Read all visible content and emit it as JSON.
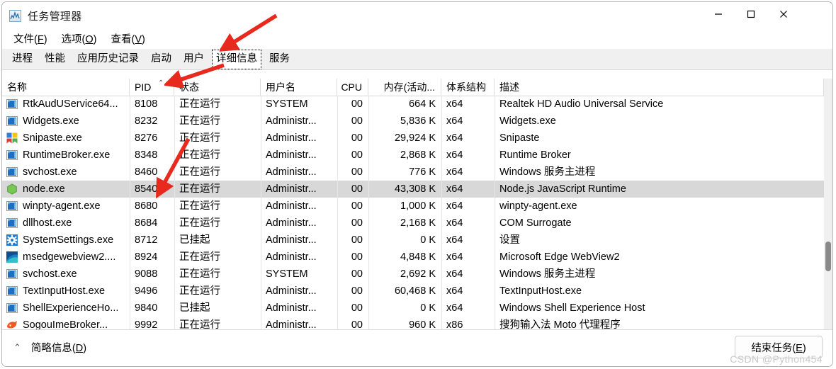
{
  "window": {
    "title": "任务管理器",
    "icon": "task-manager-icon",
    "controls": {
      "minimize": "—",
      "maximize": "□",
      "close": "✕"
    }
  },
  "menubar": [
    {
      "label": "文件",
      "mnemonic": "F"
    },
    {
      "label": "选项",
      "mnemonic": "O"
    },
    {
      "label": "查看",
      "mnemonic": "V"
    }
  ],
  "tabs": [
    {
      "label": "进程",
      "selected": false
    },
    {
      "label": "性能",
      "selected": false
    },
    {
      "label": "应用历史记录",
      "selected": false
    },
    {
      "label": "启动",
      "selected": false
    },
    {
      "label": "用户",
      "selected": false
    },
    {
      "label": "详细信息",
      "selected": true
    },
    {
      "label": "服务",
      "selected": false
    }
  ],
  "table": {
    "sort_column": "PID",
    "sort_direction": "asc",
    "columns": [
      {
        "key": "name",
        "label": "名称",
        "align": "left"
      },
      {
        "key": "pid",
        "label": "PID",
        "align": "left"
      },
      {
        "key": "state",
        "label": "状态",
        "align": "left"
      },
      {
        "key": "user",
        "label": "用户名",
        "align": "left"
      },
      {
        "key": "cpu",
        "label": "CPU",
        "align": "right"
      },
      {
        "key": "mem",
        "label": "内存(活动...",
        "align": "right"
      },
      {
        "key": "arch",
        "label": "体系结构",
        "align": "left"
      },
      {
        "key": "desc",
        "label": "描述",
        "align": "left"
      }
    ],
    "rows": [
      {
        "icon": "generic-app-icon",
        "name": "RtkAudUService64...",
        "pid": "8108",
        "state": "正在运行",
        "user": "SYSTEM",
        "cpu": "00",
        "mem": "664 K",
        "arch": "x64",
        "desc": "Realtek HD Audio Universal Service",
        "selected": false
      },
      {
        "icon": "generic-app-icon",
        "name": "Widgets.exe",
        "pid": "8232",
        "state": "正在运行",
        "user": "Administr...",
        "cpu": "00",
        "mem": "5,836 K",
        "arch": "x64",
        "desc": "Widgets.exe",
        "selected": false
      },
      {
        "icon": "snipaste-icon",
        "name": "Snipaste.exe",
        "pid": "8276",
        "state": "正在运行",
        "user": "Administr...",
        "cpu": "00",
        "mem": "29,924 K",
        "arch": "x64",
        "desc": "Snipaste",
        "selected": false
      },
      {
        "icon": "generic-app-icon",
        "name": "RuntimeBroker.exe",
        "pid": "8348",
        "state": "正在运行",
        "user": "Administr...",
        "cpu": "00",
        "mem": "2,868 K",
        "arch": "x64",
        "desc": "Runtime Broker",
        "selected": false
      },
      {
        "icon": "generic-app-icon",
        "name": "svchost.exe",
        "pid": "8460",
        "state": "正在运行",
        "user": "Administr...",
        "cpu": "00",
        "mem": "776 K",
        "arch": "x64",
        "desc": "Windows 服务主进程",
        "selected": false
      },
      {
        "icon": "nodejs-icon",
        "name": "node.exe",
        "pid": "8540",
        "state": "正在运行",
        "user": "Administr...",
        "cpu": "00",
        "mem": "43,308 K",
        "arch": "x64",
        "desc": "Node.js JavaScript Runtime",
        "selected": true
      },
      {
        "icon": "generic-app-icon",
        "name": "winpty-agent.exe",
        "pid": "8680",
        "state": "正在运行",
        "user": "Administr...",
        "cpu": "00",
        "mem": "1,000 K",
        "arch": "x64",
        "desc": "winpty-agent.exe",
        "selected": false
      },
      {
        "icon": "generic-app-icon",
        "name": "dllhost.exe",
        "pid": "8684",
        "state": "正在运行",
        "user": "Administr...",
        "cpu": "00",
        "mem": "2,168 K",
        "arch": "x64",
        "desc": "COM Surrogate",
        "selected": false
      },
      {
        "icon": "settings-gear-icon",
        "name": "SystemSettings.exe",
        "pid": "8712",
        "state": "已挂起",
        "user": "Administr...",
        "cpu": "00",
        "mem": "0 K",
        "arch": "x64",
        "desc": "设置",
        "selected": false
      },
      {
        "icon": "edge-webview-icon",
        "name": "msedgewebview2....",
        "pid": "8924",
        "state": "正在运行",
        "user": "Administr...",
        "cpu": "00",
        "mem": "4,848 K",
        "arch": "x64",
        "desc": "Microsoft Edge WebView2",
        "selected": false
      },
      {
        "icon": "generic-app-icon",
        "name": "svchost.exe",
        "pid": "9088",
        "state": "正在运行",
        "user": "SYSTEM",
        "cpu": "00",
        "mem": "2,692 K",
        "arch": "x64",
        "desc": "Windows 服务主进程",
        "selected": false
      },
      {
        "icon": "generic-app-icon",
        "name": "TextInputHost.exe",
        "pid": "9496",
        "state": "正在运行",
        "user": "Administr...",
        "cpu": "00",
        "mem": "60,468 K",
        "arch": "x64",
        "desc": "TextInputHost.exe",
        "selected": false
      },
      {
        "icon": "generic-app-icon",
        "name": "ShellExperienceHo...",
        "pid": "9840",
        "state": "已挂起",
        "user": "Administr...",
        "cpu": "00",
        "mem": "0 K",
        "arch": "x64",
        "desc": "Windows Shell Experience Host",
        "selected": false
      },
      {
        "icon": "sogou-icon",
        "name": "SogouImeBroker...",
        "pid": "9992",
        "state": "正在运行",
        "user": "Administr...",
        "cpu": "00",
        "mem": "960 K",
        "arch": "x86",
        "desc": "搜狗输入法 Moto 代理程序",
        "selected": false
      }
    ]
  },
  "bottom": {
    "brief_label": "简略信息",
    "brief_mnemonic": "D",
    "brief_chevron": "⌃",
    "end_task_label": "结束任务",
    "end_task_mnemonic": "E"
  },
  "watermark": "CSDN @Python454",
  "annotations": {
    "arrow_color": "#e8291d",
    "arrows": [
      {
        "name": "arrow-to-details-tab"
      },
      {
        "name": "arrow-to-pid-column"
      },
      {
        "name": "arrow-to-node-pid"
      }
    ]
  },
  "colors": {
    "selection": "#d8d8d8",
    "tabstrip": "#f0f0f0",
    "grid_line": "#e6e6e6",
    "scrollbar_thumb": "#8a8a8a"
  }
}
